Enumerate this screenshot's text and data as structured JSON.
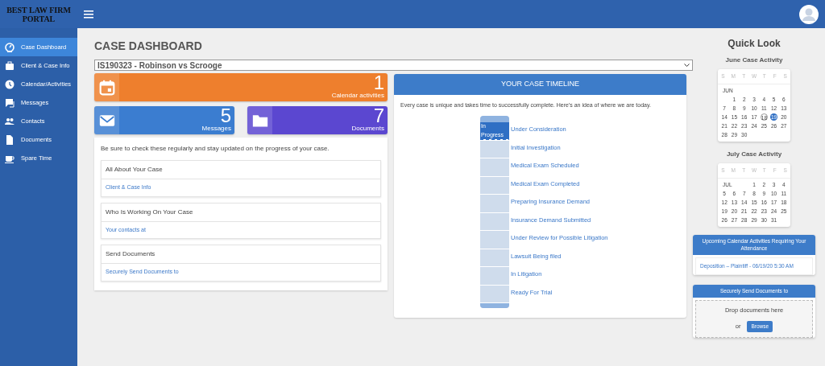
{
  "brand": {
    "title": "BEST LAW FIRM PORTAL"
  },
  "sidebar": {
    "items": [
      {
        "label": "Case Dashboard",
        "selected": true
      },
      {
        "label": "Client & Case Info",
        "selected": false
      },
      {
        "label": "Calendar/Activities",
        "selected": false
      },
      {
        "label": "Messages",
        "selected": false
      },
      {
        "label": "Contacts",
        "selected": false
      },
      {
        "label": "Documents",
        "selected": false
      },
      {
        "label": "Spare Time",
        "selected": false
      }
    ]
  },
  "page_title": "CASE DASHBOARD",
  "case_select": {
    "value": "IS190323 - Robinson vs Scrooge"
  },
  "stat_tiles": [
    {
      "count": "1",
      "label": "Calendar activities",
      "color": "#ee7f2d"
    },
    {
      "count": "5",
      "label": "Messages",
      "color": "#3b7dd0"
    },
    {
      "count": "7",
      "label": "Documents",
      "color": "#5b47d0"
    }
  ],
  "info_panel": {
    "intro": "Be sure to check these regularly and stay updated on the progress of your case.",
    "sections": [
      {
        "heading": "All About Your Case",
        "link": "Client & Case Info"
      },
      {
        "heading": "Who Is Working On Your Case",
        "link": "Your contacts at"
      },
      {
        "heading": "Send Documents",
        "link": "Securely Send Documents to"
      }
    ]
  },
  "timeline": {
    "title": "YOUR CASE TIMELINE",
    "intro": "Every case is unique and takes time to successfully complete. Here's an idea of where we are today.",
    "steps": [
      {
        "label": "Under Consideration",
        "current": true,
        "badge": "In Progress"
      },
      {
        "label": "Initial Investigation",
        "current": false
      },
      {
        "label": "Medical Exam Scheduled",
        "current": false
      },
      {
        "label": "Medical Exam Completed",
        "current": false
      },
      {
        "label": "Preparing Insurance Demand",
        "current": false
      },
      {
        "label": "Insurance Demand Submitted",
        "current": false
      },
      {
        "label": "Under Review for Possible Litigation",
        "current": false
      },
      {
        "label": "Lawsuit Being filed",
        "current": false
      },
      {
        "label": "In Litigation",
        "current": false
      },
      {
        "label": "Ready For Trial",
        "current": false
      }
    ]
  },
  "quick_look": {
    "title": "Quick Look",
    "calendars": [
      {
        "title": "June Case Activity",
        "weekdays": [
          "S",
          "M",
          "T",
          "W",
          "T",
          "F",
          "S"
        ],
        "month": "JUN",
        "weeks": [
          {
            "days": [
              "1",
              "2",
              "3",
              "4",
              "5",
              "6"
            ]
          },
          {
            "days": [
              "7",
              "8",
              "9",
              "10",
              "11",
              "12",
              "13"
            ]
          },
          {
            "days": [
              "14",
              "15",
              "16",
              "17",
              {
                "day": "18",
                "kind": "today"
              },
              {
                "day": "19",
                "kind": "event"
              },
              "20"
            ]
          },
          {
            "days": [
              "21",
              "22",
              "23",
              "24",
              "25",
              "26",
              "27"
            ]
          },
          {
            "days": [
              "28",
              "29",
              "30"
            ]
          }
        ]
      },
      {
        "title": "July Case Activity",
        "weekdays": [
          "S",
          "M",
          "T",
          "W",
          "T",
          "F",
          "S"
        ],
        "month": "JUL",
        "weeks": [
          {
            "days": [
              "1",
              "2",
              "3",
              "4"
            ]
          },
          {
            "days": [
              "5",
              "6",
              "7",
              "8",
              "9",
              "10",
              "11"
            ]
          },
          {
            "days": [
              "12",
              "13",
              "14",
              "15",
              "16",
              "17",
              "18"
            ]
          },
          {
            "days": [
              "19",
              "20",
              "21",
              "22",
              "23",
              "24",
              "25"
            ]
          },
          {
            "days": [
              "26",
              "27",
              "28",
              "29",
              "30",
              "31"
            ]
          }
        ]
      }
    ],
    "upcoming": {
      "title": "Upcoming Calendar Activities Requiring Your Attendance",
      "items": [
        "Deposition – Plaintiff - 06/19/20 5:30 AM"
      ]
    },
    "upload": {
      "title": "Securely Send Documents to",
      "drop_text": "Drop documents here",
      "or_text": "or",
      "button": "Browse"
    }
  }
}
